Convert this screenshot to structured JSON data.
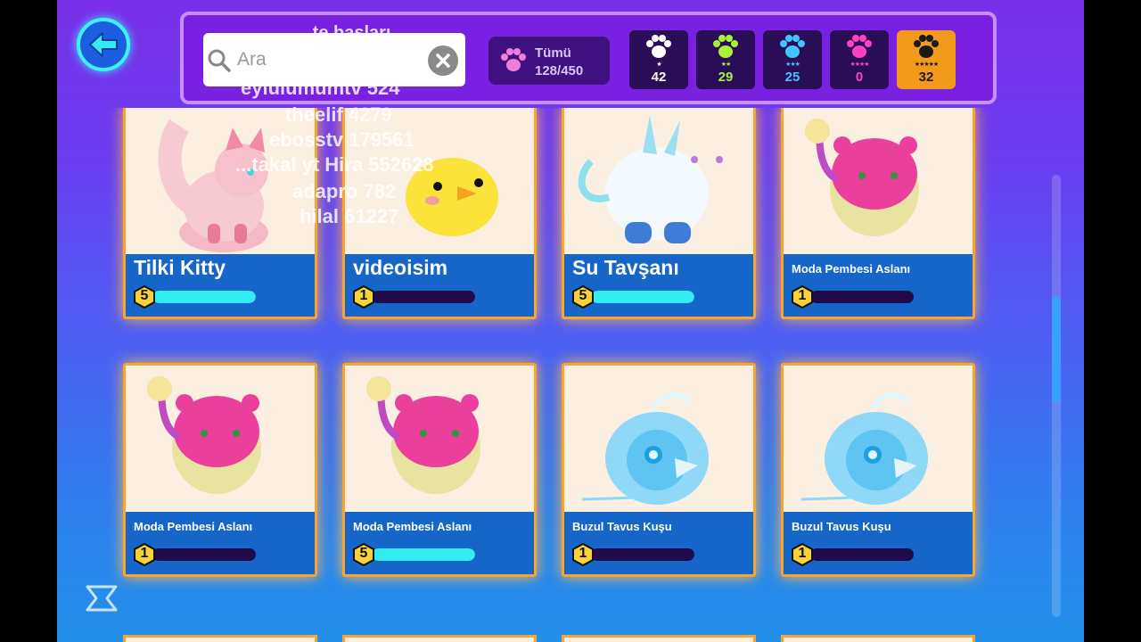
{
  "search": {
    "placeholder": "Ara"
  },
  "filters": {
    "all": {
      "label": "Tümü",
      "count": "128/450"
    },
    "rarities": [
      {
        "stars": "★",
        "count": "42",
        "color": "#ffffff",
        "active": false
      },
      {
        "stars": "★★",
        "count": "29",
        "color": "#a9f23a",
        "active": false
      },
      {
        "stars": "★★★",
        "count": "25",
        "color": "#3fc5ff",
        "active": false
      },
      {
        "stars": "★★★★",
        "count": "0",
        "color": "#ff3fc6",
        "active": false
      },
      {
        "stars": "★★★★★",
        "count": "32",
        "color": "#1a1a1a",
        "active": true
      }
    ]
  },
  "pets": [
    {
      "name": "Tilki Kitty",
      "level": "5",
      "progress": 1.0
    },
    {
      "name": "videoisim",
      "level": "1",
      "progress": 0
    },
    {
      "name": "Su Tavşanı",
      "level": "5",
      "progress": 1.0
    },
    {
      "name": "Moda Pembesi Aslanı",
      "level": "1",
      "progress": 0
    },
    {
      "name": "Moda Pembesi Aslanı",
      "level": "1",
      "progress": 0
    },
    {
      "name": "Moda Pembesi Aslanı",
      "level": "5",
      "progress": 1.0
    },
    {
      "name": "Buzul Tavus Kuşu",
      "level": "1",
      "progress": 0
    },
    {
      "name": "Buzul Tavus Kuşu",
      "level": "1",
      "progress": 0
    }
  ],
  "overlay_lines": [
    "...te başları",
    "eylulumumtv 524",
    "theelif 4279",
    "ebosstv 179561",
    "...takal yt Hira 552628",
    "adapro 782",
    "hilal 61227"
  ]
}
